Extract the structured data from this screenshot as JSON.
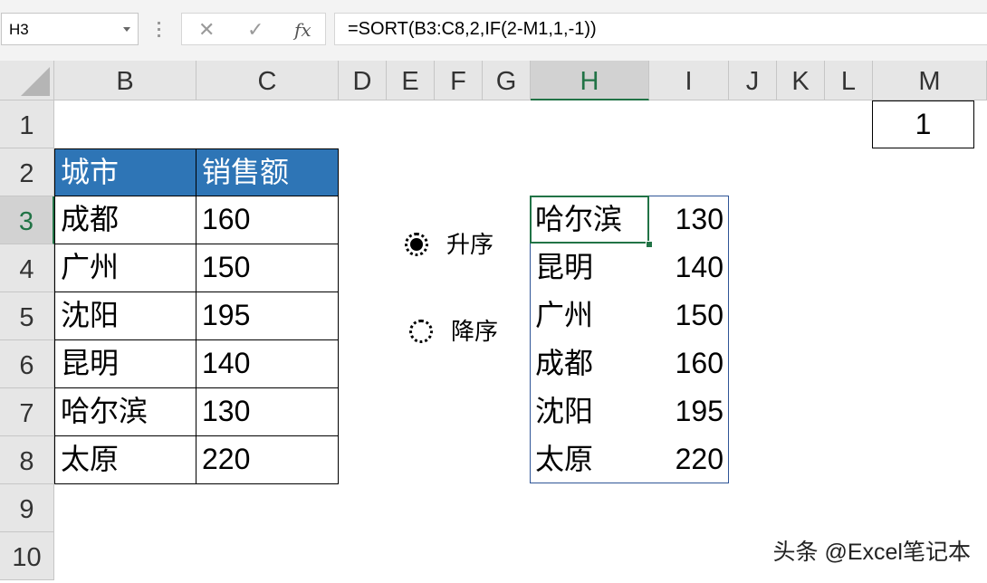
{
  "name_box": "H3",
  "formula_buttons": {
    "cancel": "✕",
    "enter": "✓",
    "fx": "fx"
  },
  "formula": "=SORT(B3:C8,2,IF(2-M1,1,-1))",
  "columns": [
    "B",
    "C",
    "D",
    "E",
    "F",
    "G",
    "H",
    "I",
    "J",
    "K",
    "L",
    "M"
  ],
  "rows": [
    "1",
    "2",
    "3",
    "4",
    "5",
    "6",
    "7",
    "8",
    "9",
    "10"
  ],
  "source_table": {
    "headers": [
      "城市",
      "销售额"
    ],
    "rows": [
      [
        "成都",
        "160"
      ],
      [
        "广州",
        "150"
      ],
      [
        "沈阳",
        "195"
      ],
      [
        "昆明",
        "140"
      ],
      [
        "哈尔滨",
        "130"
      ],
      [
        "太原",
        "220"
      ]
    ]
  },
  "sorted_result": [
    [
      "哈尔滨",
      "130"
    ],
    [
      "昆明",
      "140"
    ],
    [
      "广州",
      "150"
    ],
    [
      "成都",
      "160"
    ],
    [
      "沈阳",
      "195"
    ],
    [
      "太原",
      "220"
    ]
  ],
  "m1_value": "1",
  "radio_ascending": {
    "label": "升序",
    "selected": true
  },
  "radio_descending": {
    "label": "降序",
    "selected": false
  },
  "watermark": "头条 @Excel笔记本",
  "colors": {
    "header_fill": "#2e75b6",
    "selection": "#217346",
    "result_border": "#2f5597"
  }
}
